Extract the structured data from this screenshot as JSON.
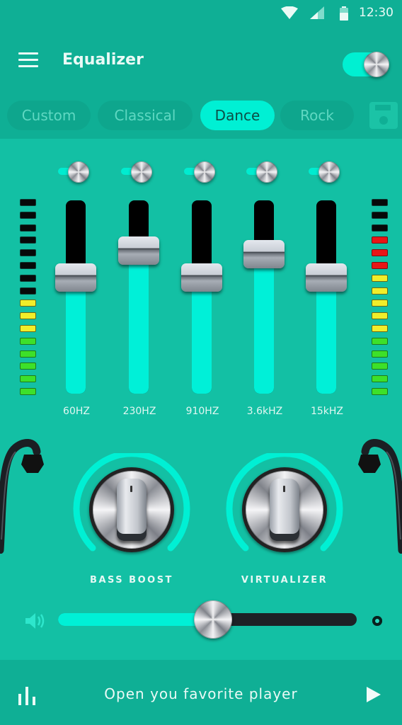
{
  "status_bar": {
    "time": "12:30",
    "icons": [
      "wifi-icon",
      "signal-icon",
      "battery-icon"
    ]
  },
  "header": {
    "title": "Equalizer",
    "menu_icon": "hamburger-menu-icon",
    "power_toggle": {
      "on": true
    }
  },
  "presets": {
    "items": [
      {
        "label": "Custom",
        "active": false
      },
      {
        "label": "Classical",
        "active": false
      },
      {
        "label": "Dance",
        "active": true
      },
      {
        "label": "Rock",
        "active": false
      }
    ],
    "save_icon": "floppy-disk-icon"
  },
  "meters": {
    "left": [
      "off",
      "off",
      "off",
      "off",
      "off",
      "off",
      "off",
      "off",
      "yellow",
      "yellow",
      "yellow",
      "green",
      "green",
      "green",
      "green",
      "green"
    ],
    "right": [
      "off",
      "off",
      "off",
      "red",
      "red",
      "red",
      "yellow",
      "yellow",
      "yellow",
      "yellow",
      "yellow",
      "green",
      "green",
      "green",
      "green",
      "green"
    ]
  },
  "bands": [
    {
      "label": "60HZ",
      "level": 0.6,
      "enabled": true
    },
    {
      "label": "230HZ",
      "level": 0.74,
      "enabled": true
    },
    {
      "label": "910HZ",
      "level": 0.6,
      "enabled": true
    },
    {
      "label": "3.6kHZ",
      "level": 0.72,
      "enabled": true
    },
    {
      "label": "15kHZ",
      "level": 0.6,
      "enabled": true
    }
  ],
  "dials": [
    {
      "label": "BASS BOOST",
      "value": 0.5
    },
    {
      "label": "VIRTUALIZER",
      "value": 0.5
    }
  ],
  "volume": {
    "level": 0.52,
    "icon": "speaker-icon"
  },
  "bottom_bar": {
    "text": "Open you favorite player",
    "left_icon": "equalizer-bars-icon",
    "right_icon": "play-icon"
  },
  "colors": {
    "accent": "#00f0d4",
    "background": "#13c0a4",
    "header": "#0faf95"
  }
}
